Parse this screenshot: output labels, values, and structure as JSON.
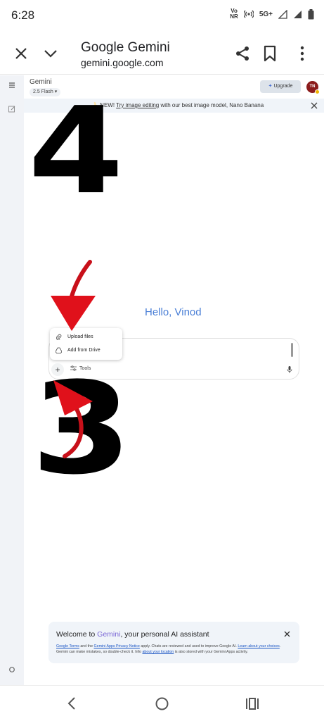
{
  "status_bar": {
    "time": "6:28",
    "volte": "Vo³\nNR",
    "network": "5G+"
  },
  "tab": {
    "title": "Google Gemini",
    "url": "gemini.google.com",
    "icons": [
      "close-icon",
      "chevron-down-icon",
      "share-icon",
      "bookmark-icon",
      "more-vert-icon"
    ]
  },
  "gemini": {
    "brand": "Gemini",
    "model": "2.5 Flash ▾",
    "upgrade_label": "Upgrade",
    "avatar_initials": "TN",
    "banner": {
      "prefix": "🍌 NEW! ",
      "link": "Try image editing",
      "suffix": " with our best image model, Nano Banana"
    },
    "greeting": "Hello, Vinod",
    "tools_label": "Tools",
    "popup": {
      "upload": "Upload files",
      "drive": "Add from Drive"
    },
    "welcome": {
      "title_prefix": "Welcome to ",
      "title_brand": "Gemini",
      "title_suffix": ", your personal AI assistant",
      "link_terms": "Google Terms",
      "text_and": " and the ",
      "link_privacy": "Gemini Apps Privacy Notice",
      "text_apply": " apply. Chats are reviewed and used to improve Google AI. ",
      "link_learn": "Learn about your choices",
      "text_mistakes": ". Gemini can make mistakes, so double-check it. Info ",
      "link_location": "about your location",
      "text_end": " is also stored with your Gemini Apps activity."
    }
  },
  "annotations": {
    "step_top": "4",
    "step_bottom": "3",
    "arrow_color": "#e0111b"
  },
  "colors": {
    "greeting": "#4a7fd6",
    "rail": "#f1f3f7",
    "banner": "#f0f4f9"
  }
}
